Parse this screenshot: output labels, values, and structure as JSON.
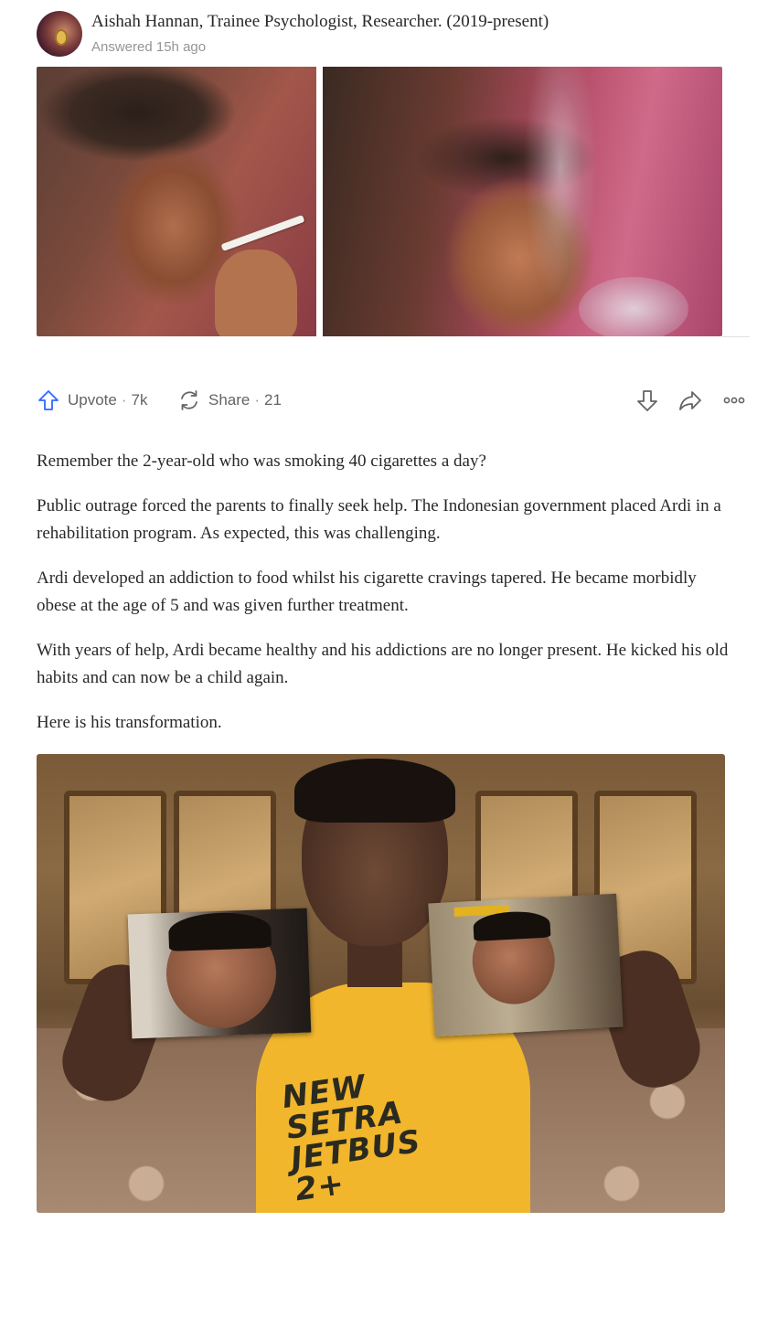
{
  "author": {
    "name": "Aishah Hannan, Trainee Psychologist, Researcher. (2019-present)",
    "answered": "Answered 15h ago",
    "avatar_alt": "avatar"
  },
  "actions": {
    "upvote_label": "Upvote",
    "upvote_count": "7k",
    "share_label": "Share",
    "share_count": "21",
    "separator": "·"
  },
  "icons": {
    "upvote": "arrow-up-icon",
    "share": "refresh-share-icon",
    "downvote": "arrow-down-icon",
    "forward": "forward-arrow-icon",
    "more": "more-dots-icon"
  },
  "paragraphs": [
    "Remember the 2-year-old who was smoking 40 cigarettes a day?",
    "Public outrage forced the parents to finally seek help. The Indonesian government placed Ardi in a rehabilitation program. As expected, this was challenging.",
    "Ardi developed an addiction to food whilst his cigarette cravings tapered. He became morbidly obese at the age of 5 and was given further treatment.",
    "With years of help, Ardi became healthy and his addictions are no longer present. He kicked his old habits and can now be a child again.",
    "Here is his transformation."
  ],
  "bottom_photo": {
    "shirt_text": "NEW SETRA JETBUS 2+"
  },
  "colors": {
    "upvote_accent": "#2e69ff",
    "text": "#282829",
    "secondary_text": "#636466",
    "muted_text": "#939598"
  }
}
